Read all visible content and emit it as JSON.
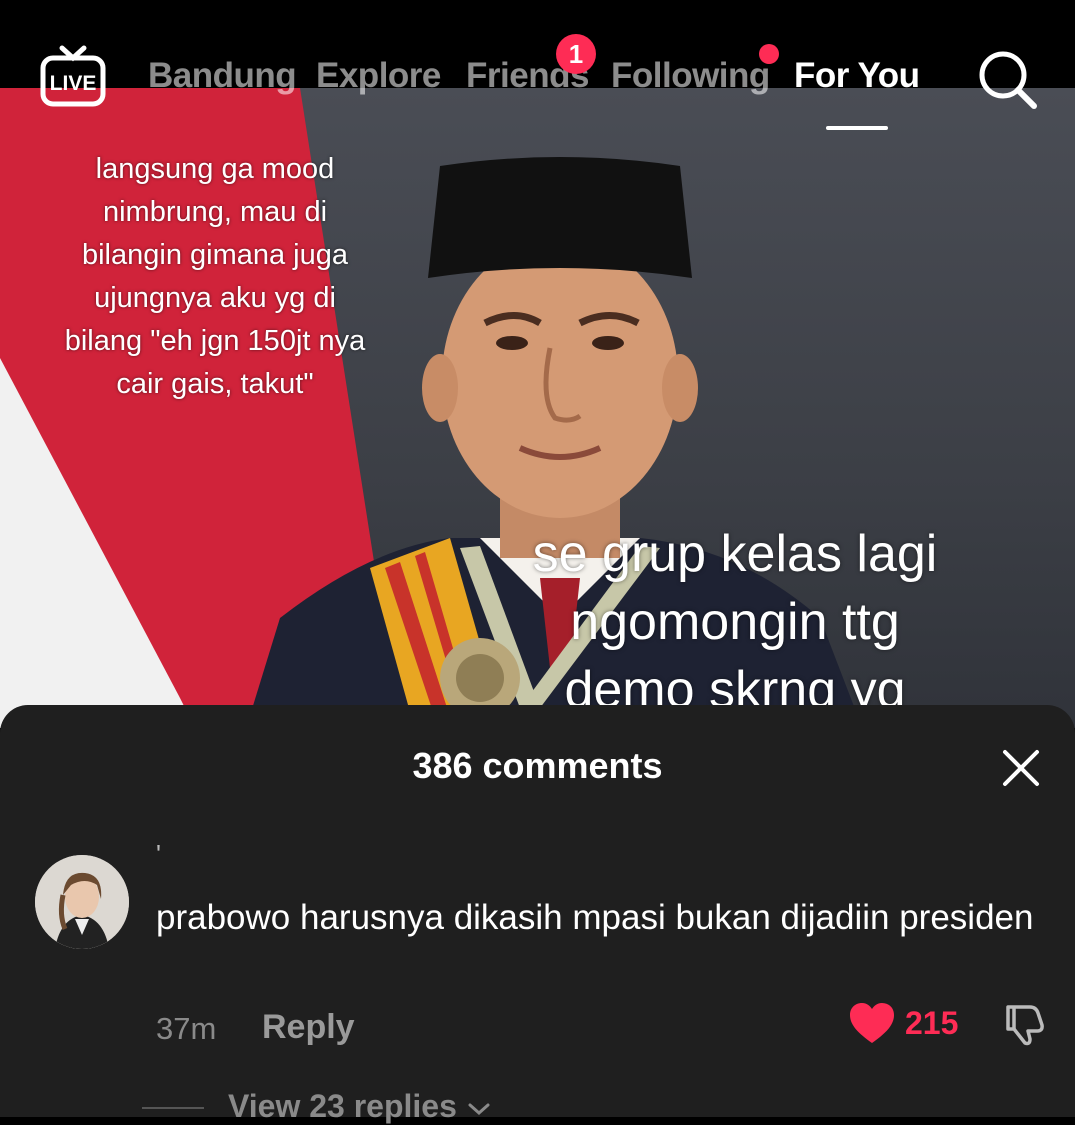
{
  "nav": {
    "live_label": "LIVE",
    "tabs": [
      {
        "label": "Bandung"
      },
      {
        "label": "Explore"
      },
      {
        "label": "Friends"
      },
      {
        "label": "Following"
      },
      {
        "label": "For You"
      }
    ],
    "friends_badge": "1",
    "active_tab": "For You"
  },
  "video": {
    "caption_1": "langsung ga mood nimbrung, mau di bilangin gimana juga ujungnya aku yg di bilang \"eh jgn 150jt nya cair gais, takut\"",
    "caption_2": "se grup kelas lagi ngomongin ttg demo skrng yg"
  },
  "comments": {
    "title": "386 comments",
    "items": [
      {
        "username": "'",
        "text": "prabowo harusnya dikasih mpasi bukan dijadiin presiden",
        "time": "37m",
        "reply_label": "Reply",
        "likes": "215",
        "view_replies": "View 23 replies"
      }
    ]
  },
  "colors": {
    "accent": "#fe2c55",
    "sheet_bg": "#1f1f1f"
  }
}
